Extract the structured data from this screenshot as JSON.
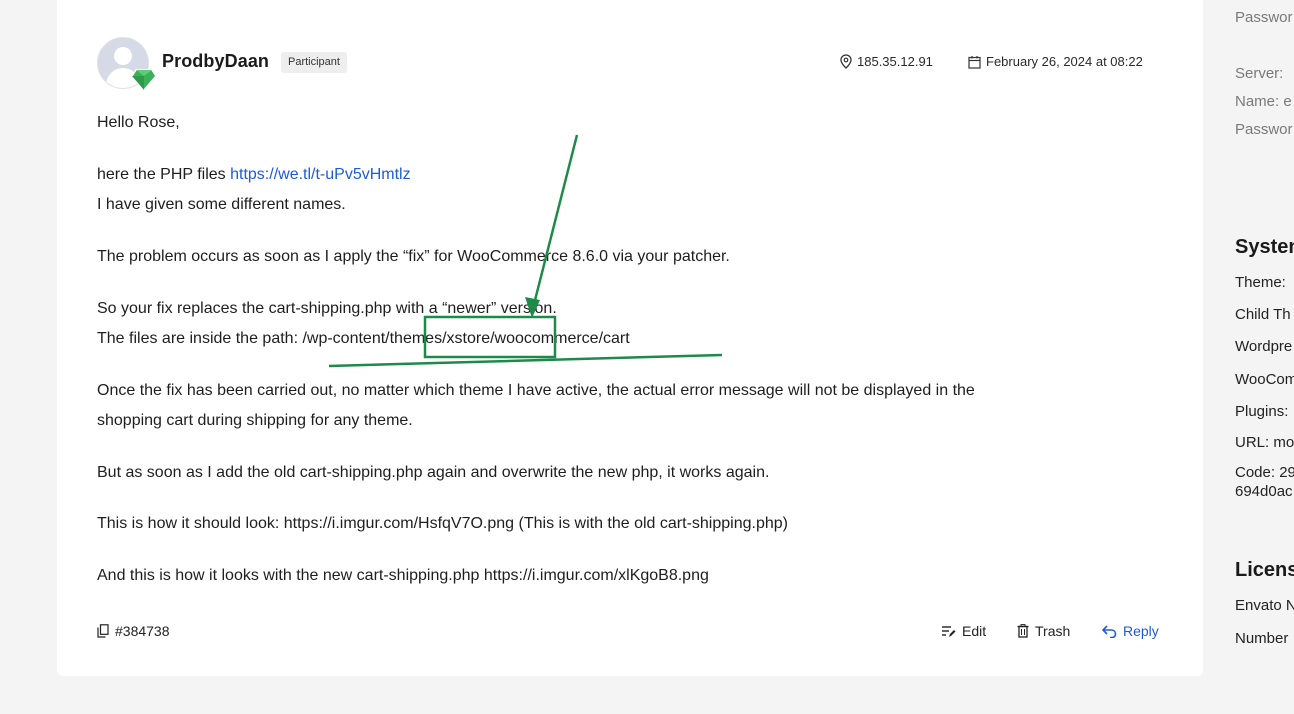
{
  "post": {
    "author": "ProdbyDaan",
    "role_badge": "Participant",
    "ip": "185.35.12.91",
    "date": "February 26, 2024 at 08:22",
    "lines": {
      "greeting": "Hello Rose,",
      "files_prefix": "here the PHP files ",
      "files_link": "https://we.tl/t-uPv5vHmtlz",
      "names": "I have given some different names.",
      "problem": "The problem occurs as soon as I apply the “fix” for WooCommerce 8.6.0 via your patcher.",
      "replaces": "So your fix replaces the cart-shipping.php with a “newer” version.",
      "path": "The files are inside the path: /wp-content/themes/xstore/woocommerce/cart",
      "once_1": "Once the fix has been carried out, no matter which theme I have active, the actual error message will not be displayed in the",
      "once_2": "shopping cart during shipping for any theme.",
      "but": "But as soon as I add the old cart-shipping.php again and overwrite the new php, it works again.",
      "should": "This is how it should look: https://i.imgur.com/HsfqV7O.png (This is with the old cart-shipping.php)",
      "looks": "And this is how it looks with the new cart-shipping.php https://i.imgur.com/xlKgoB8.png"
    },
    "post_id": "#384738",
    "actions": {
      "edit": "Edit",
      "trash": "Trash",
      "reply": "Reply"
    }
  },
  "sidebar": {
    "items": [
      {
        "text": "Passwor",
        "style": "grey"
      },
      {
        "text": "Server: ",
        "style": "grey"
      },
      {
        "text": "Name: e",
        "style": "grey"
      },
      {
        "text": "Passwor",
        "style": "grey"
      },
      {
        "text": "System",
        "style": "heading"
      },
      {
        "text": "Theme: ",
        "style": "normal"
      },
      {
        "text": "Child Th",
        "style": "normal"
      },
      {
        "text": "Wordpre",
        "style": "normal"
      },
      {
        "text": "WooCom",
        "style": "normal"
      },
      {
        "text": "Plugins: ",
        "style": "normal"
      },
      {
        "text": "URL: mo",
        "style": "normal"
      },
      {
        "text": "Code: 29",
        "style": "normal"
      },
      {
        "text": "694d0ac",
        "style": "normal"
      },
      {
        "text": "License",
        "style": "heading"
      },
      {
        "text": "Envato N",
        "style": "normal"
      },
      {
        "text": "Number",
        "style": "normal"
      }
    ]
  },
  "colors": {
    "link": "#1e5bd8",
    "annotation": "#1e8a4a",
    "background": "#f4f4f4"
  }
}
